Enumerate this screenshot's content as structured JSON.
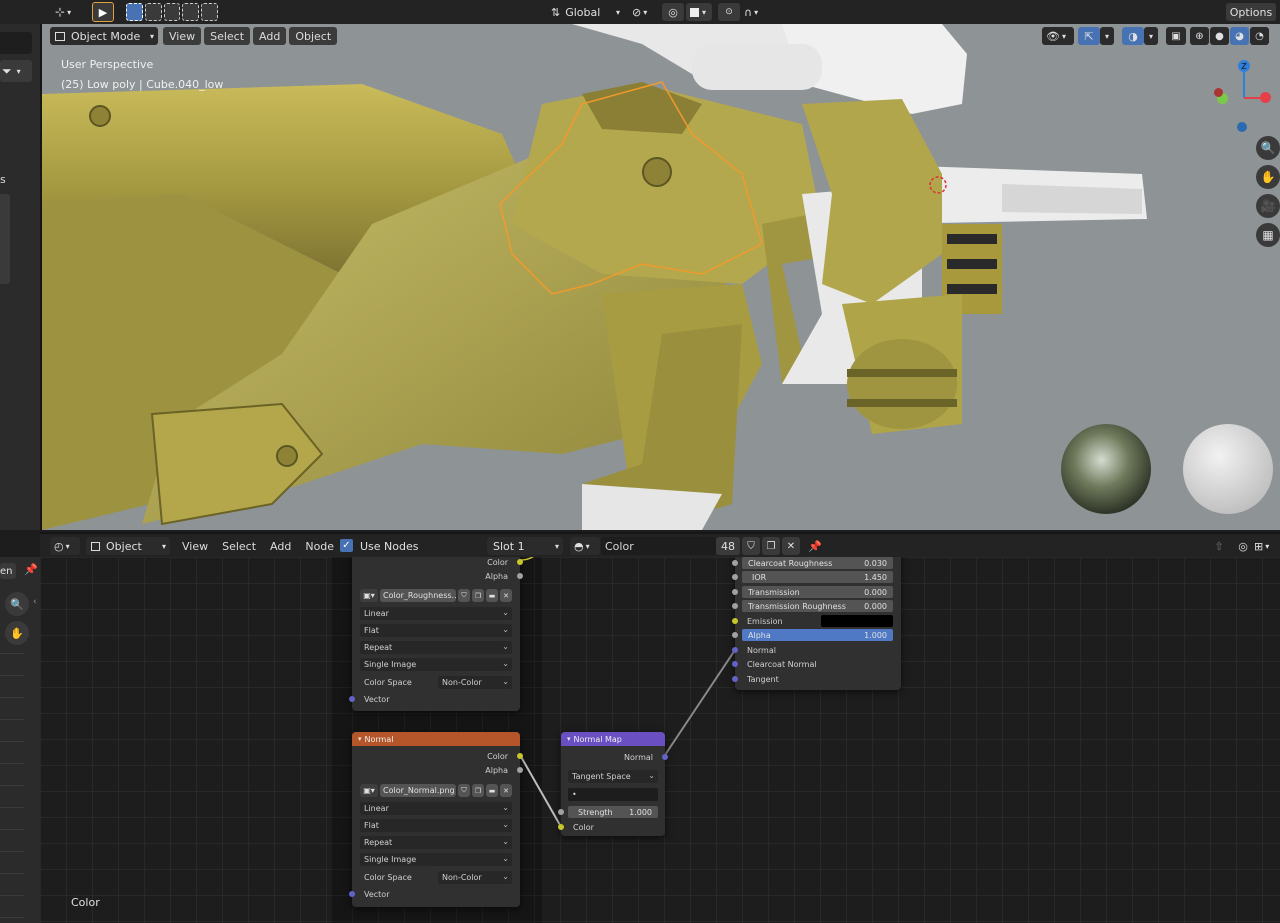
{
  "top_toolbar": {
    "transform_orientation": "Global",
    "options_label": "Options"
  },
  "viewport": {
    "mode": "Object Mode",
    "menus": [
      "View",
      "Select",
      "Add",
      "Object"
    ],
    "overlay_line1": "User Perspective",
    "overlay_line2": "(25) Low poly | Cube.040_low",
    "gizmo_axis_label": "Z"
  },
  "node_header": {
    "object_label": "Object",
    "menus": [
      "View",
      "Select",
      "Add",
      "Node"
    ],
    "use_nodes_label": "Use Nodes",
    "use_nodes_checked": true,
    "slot": "Slot 1",
    "material_name": "Color",
    "user_count": "48"
  },
  "left_panel": {
    "partial_label": "en",
    "partial_label2": "s",
    "bottom_label": "Color"
  },
  "roughness_node": {
    "outputs": [
      "Color",
      "Alpha"
    ],
    "image_name": "Color_Roughness...",
    "interpolation": "Linear",
    "projection": "Flat",
    "extension": "Repeat",
    "source": "Single Image",
    "color_space_label": "Color Space",
    "color_space": "Non-Color",
    "input": "Vector"
  },
  "normal_node": {
    "title": "Normal",
    "outputs": [
      "Color",
      "Alpha"
    ],
    "image_name": "Color_Normal.png",
    "interpolation": "Linear",
    "projection": "Flat",
    "extension": "Repeat",
    "source": "Single Image",
    "color_space_label": "Color Space",
    "color_space": "Non-Color",
    "input": "Vector"
  },
  "normal_map_node": {
    "title": "Normal Map",
    "output": "Normal",
    "space": "Tangent Space",
    "uv_map": "•",
    "strength_label": "Strength",
    "strength_value": "1.000",
    "input": "Color"
  },
  "bsdf_node": {
    "fields": [
      {
        "label": "Clearcoat Roughness",
        "value": "0.030"
      },
      {
        "label": "IOR",
        "value": "1.450"
      },
      {
        "label": "Transmission",
        "value": "0.000"
      },
      {
        "label": "Transmission Roughness",
        "value": "0.000"
      }
    ],
    "emission_label": "Emission",
    "alpha_label": "Alpha",
    "alpha_value": "1.000",
    "inputs": [
      "Normal",
      "Clearcoat Normal",
      "Tangent"
    ]
  },
  "colors": {
    "node_header_orange": "#b4552a",
    "node_header_purple": "#6a4fc3",
    "alpha_blue": "#4f79c5",
    "yellow_model": "#b5a84a",
    "viewport_bg": "#8e9396"
  }
}
